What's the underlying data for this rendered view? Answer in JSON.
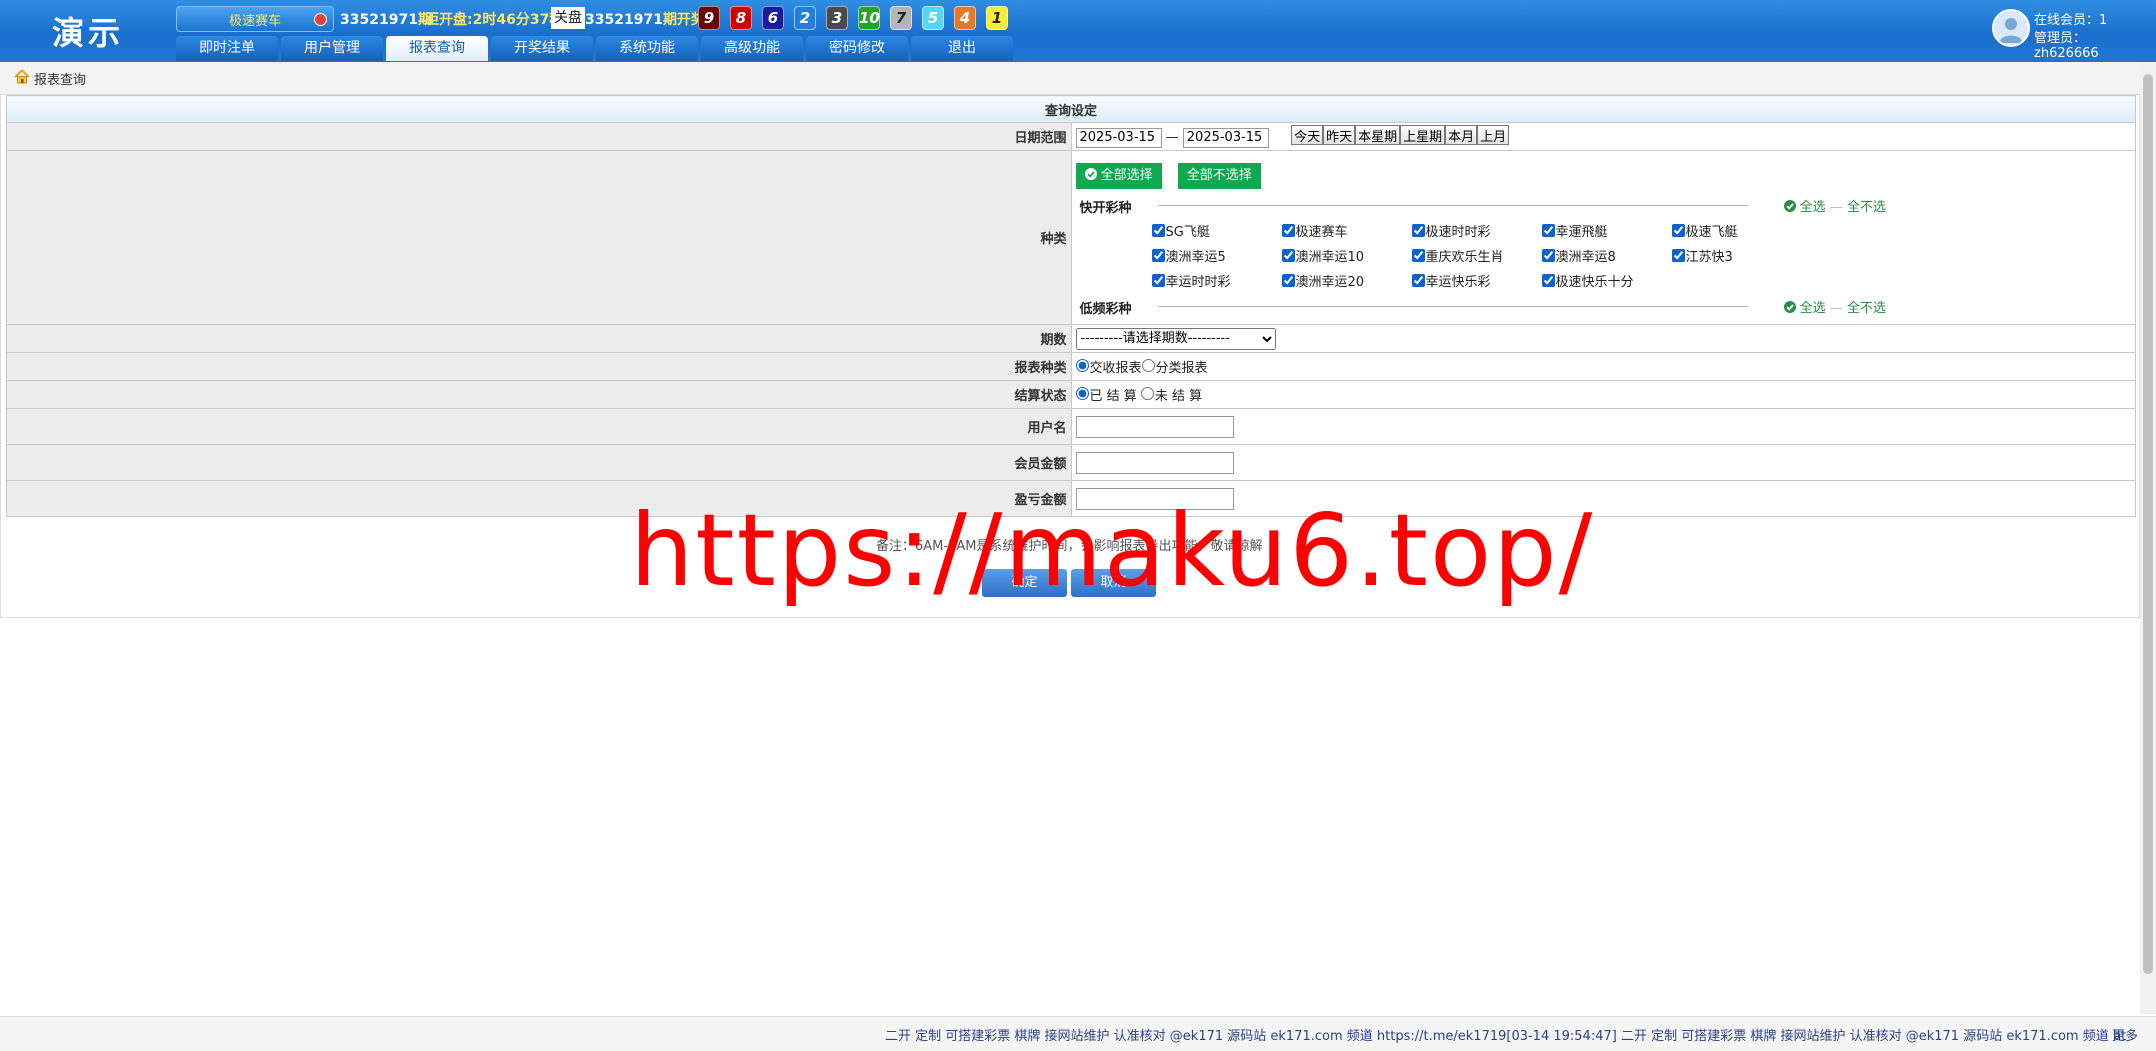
{
  "logo": "演示",
  "game_select": "极速赛车",
  "period": {
    "number": "33521971",
    "unit": "期"
  },
  "countdown": "距开盘:2时46分37秒",
  "status": "关盘",
  "draw": {
    "number": "33521971",
    "label": "期开奖:"
  },
  "balls": [
    {
      "n": "9",
      "bg": "#6b0000",
      "fg": "#ffffff"
    },
    {
      "n": "8",
      "bg": "#d10000",
      "fg": "#ffffff"
    },
    {
      "n": "6",
      "bg": "#1a1aa0",
      "fg": "#ffffff"
    },
    {
      "n": "2",
      "bg": "#1e7fe0",
      "fg": "#ffffff"
    },
    {
      "n": "3",
      "bg": "#4a4a4a",
      "fg": "#ffffff"
    },
    {
      "n": "10",
      "bg": "#27a327",
      "fg": "#ffffff"
    },
    {
      "n": "7",
      "bg": "#b5b5b5",
      "fg": "#222222"
    },
    {
      "n": "5",
      "bg": "#5bd3f5",
      "fg": "#ffffff"
    },
    {
      "n": "4",
      "bg": "#e8772a",
      "fg": "#ffffff"
    },
    {
      "n": "1",
      "bg": "#f6ee33",
      "fg": "#222222"
    }
  ],
  "nav": [
    "即时注单",
    "用户管理",
    "报表查询",
    "开奖结果",
    "系统功能",
    "高级功能",
    "密码修改",
    "退出"
  ],
  "user": {
    "online": "在线会员：1",
    "admin": "管理员：zh626666"
  },
  "breadcrumb": "报表查询",
  "form": {
    "caption": "查询设定",
    "date_label": "日期范围",
    "date_from": "2025-03-15",
    "date_sep": "—",
    "date_to": "2025-03-15",
    "quick_dates": [
      "今天",
      "昨天",
      "本星期",
      "上星期",
      "本月",
      "上月"
    ],
    "type_label": "种类",
    "select_all": "全部选择",
    "select_none": "全部不选择",
    "fast_group": "快开彩种",
    "slow_group": "低频彩种",
    "group_all": "全选",
    "group_none": "全不选",
    "fast_games": [
      "SG飞艇",
      "极速赛车",
      "极速时时彩",
      "幸運飛艇",
      "极速飞艇",
      "澳洲幸运5",
      "澳洲幸运10",
      "重庆欢乐生肖",
      "澳洲幸运8",
      "江苏快3",
      "幸运时时彩",
      "澳洲幸运20",
      "幸运快乐彩",
      "极速快乐十分"
    ],
    "period_label": "期数",
    "period_placeholder": "---------请选择期数---------",
    "report_type_label": "报表种类",
    "report_types": [
      "交收报表",
      "分类报表"
    ],
    "settle_label": "结算状态",
    "settle_options": [
      "已 结 算",
      "未 结 算"
    ],
    "username_label": "用户名",
    "member_amount_label": "会员金额",
    "profit_amount_label": "盈亏金额",
    "note": "备注：6AM-7AM是系统维护时间，会影响报表导出功能，敬请谅解",
    "confirm": "确定",
    "cancel": "取消"
  },
  "watermark": "https://maku6.top/",
  "footer": {
    "ticker": "二开 定制 可搭建彩票 棋牌 接网站维护 认准核对 @ek171 源码站 ek171.com 频道 https://t.me/ek1719[03-14 19:54:47] 二开 定制 可搭建彩票 棋牌 接网站维护 认准核对 @ek171 源码站 ek171.com 频道 ht",
    "more": "更多"
  }
}
